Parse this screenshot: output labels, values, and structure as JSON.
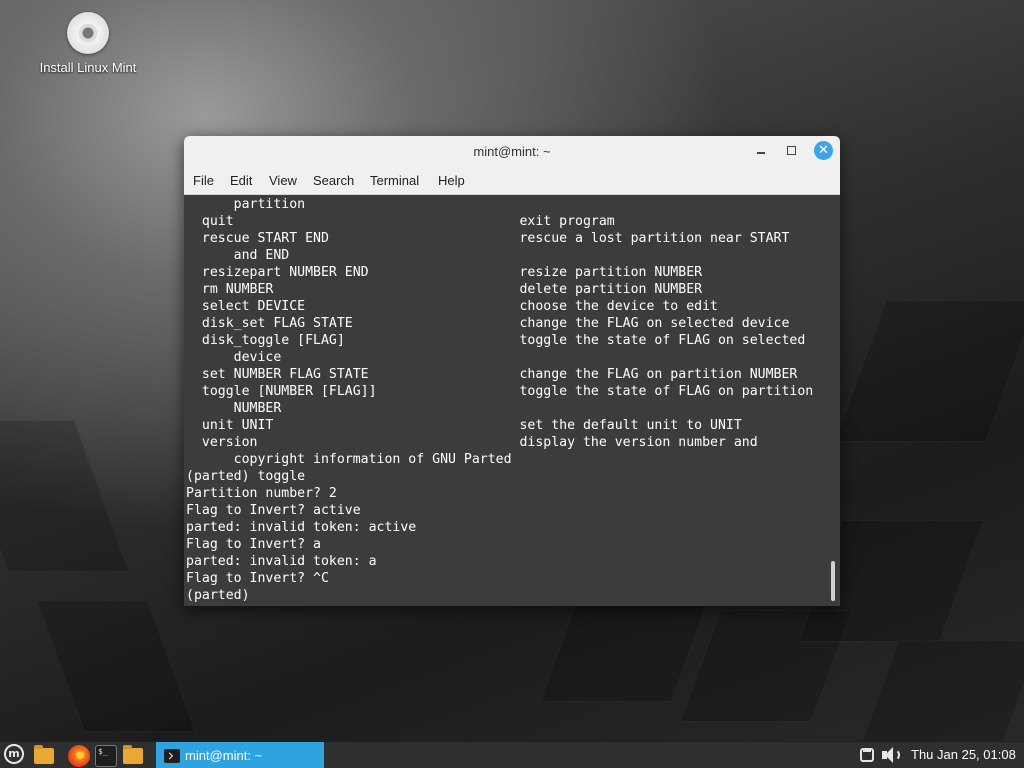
{
  "desktop": {
    "icon_label": "Install Linux Mint"
  },
  "window": {
    "title": "mint@mint: ~",
    "close_glyph": "✕",
    "menu": [
      "File",
      "Edit",
      "View",
      "Search",
      "Terminal",
      "Help"
    ]
  },
  "terminal": {
    "lines": [
      "      partition",
      "  quit                                    exit program",
      "  rescue START END                        rescue a lost partition near START",
      "      and END",
      "  resizepart NUMBER END                   resize partition NUMBER",
      "  rm NUMBER                               delete partition NUMBER",
      "  select DEVICE                           choose the device to edit",
      "  disk_set FLAG STATE                     change the FLAG on selected device",
      "  disk_toggle [FLAG]                      toggle the state of FLAG on selected",
      "      device",
      "  set NUMBER FLAG STATE                   change the FLAG on partition NUMBER",
      "  toggle [NUMBER [FLAG]]                  toggle the state of FLAG on partition",
      "      NUMBER",
      "  unit UNIT                               set the default unit to UNIT",
      "  version                                 display the version number and",
      "      copyright information of GNU Parted",
      "(parted) toggle",
      "Partition number? 2",
      "Flag to Invert? active",
      "parted: invalid token: active",
      "Flag to Invert? a",
      "parted: invalid token: a",
      "Flag to Invert? ^C",
      "(parted)"
    ]
  },
  "taskbar": {
    "menu_glyph": "m",
    "terminal_glyph": "$_",
    "task_label": "mint@mint: ~",
    "clock": "Thu Jan 25, 01:08"
  },
  "colors": {
    "accent": "#2fa3df",
    "terminal_bg": "#3c3c3c",
    "panel_bg": "#2f2f2f"
  },
  "icons": {
    "desktop": "disc-icon",
    "panel": [
      "mint-menu-icon",
      "files-icon",
      "firefox-icon",
      "terminal-icon",
      "files-icon"
    ],
    "tray": [
      "window-list-icon",
      "volume-icon"
    ]
  }
}
